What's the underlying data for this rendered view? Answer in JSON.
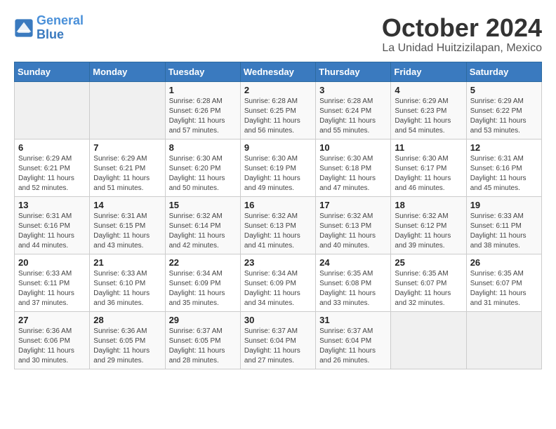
{
  "logo": {
    "line1": "General",
    "line2": "Blue"
  },
  "title": "October 2024",
  "location": "La Unidad Huitzizilapan, Mexico",
  "weekdays": [
    "Sunday",
    "Monday",
    "Tuesday",
    "Wednesday",
    "Thursday",
    "Friday",
    "Saturday"
  ],
  "weeks": [
    [
      {
        "day": "",
        "info": ""
      },
      {
        "day": "",
        "info": ""
      },
      {
        "day": "1",
        "info": "Sunrise: 6:28 AM\nSunset: 6:26 PM\nDaylight: 11 hours and 57 minutes."
      },
      {
        "day": "2",
        "info": "Sunrise: 6:28 AM\nSunset: 6:25 PM\nDaylight: 11 hours and 56 minutes."
      },
      {
        "day": "3",
        "info": "Sunrise: 6:28 AM\nSunset: 6:24 PM\nDaylight: 11 hours and 55 minutes."
      },
      {
        "day": "4",
        "info": "Sunrise: 6:29 AM\nSunset: 6:23 PM\nDaylight: 11 hours and 54 minutes."
      },
      {
        "day": "5",
        "info": "Sunrise: 6:29 AM\nSunset: 6:22 PM\nDaylight: 11 hours and 53 minutes."
      }
    ],
    [
      {
        "day": "6",
        "info": "Sunrise: 6:29 AM\nSunset: 6:21 PM\nDaylight: 11 hours and 52 minutes."
      },
      {
        "day": "7",
        "info": "Sunrise: 6:29 AM\nSunset: 6:21 PM\nDaylight: 11 hours and 51 minutes."
      },
      {
        "day": "8",
        "info": "Sunrise: 6:30 AM\nSunset: 6:20 PM\nDaylight: 11 hours and 50 minutes."
      },
      {
        "day": "9",
        "info": "Sunrise: 6:30 AM\nSunset: 6:19 PM\nDaylight: 11 hours and 49 minutes."
      },
      {
        "day": "10",
        "info": "Sunrise: 6:30 AM\nSunset: 6:18 PM\nDaylight: 11 hours and 47 minutes."
      },
      {
        "day": "11",
        "info": "Sunrise: 6:30 AM\nSunset: 6:17 PM\nDaylight: 11 hours and 46 minutes."
      },
      {
        "day": "12",
        "info": "Sunrise: 6:31 AM\nSunset: 6:16 PM\nDaylight: 11 hours and 45 minutes."
      }
    ],
    [
      {
        "day": "13",
        "info": "Sunrise: 6:31 AM\nSunset: 6:16 PM\nDaylight: 11 hours and 44 minutes."
      },
      {
        "day": "14",
        "info": "Sunrise: 6:31 AM\nSunset: 6:15 PM\nDaylight: 11 hours and 43 minutes."
      },
      {
        "day": "15",
        "info": "Sunrise: 6:32 AM\nSunset: 6:14 PM\nDaylight: 11 hours and 42 minutes."
      },
      {
        "day": "16",
        "info": "Sunrise: 6:32 AM\nSunset: 6:13 PM\nDaylight: 11 hours and 41 minutes."
      },
      {
        "day": "17",
        "info": "Sunrise: 6:32 AM\nSunset: 6:13 PM\nDaylight: 11 hours and 40 minutes."
      },
      {
        "day": "18",
        "info": "Sunrise: 6:32 AM\nSunset: 6:12 PM\nDaylight: 11 hours and 39 minutes."
      },
      {
        "day": "19",
        "info": "Sunrise: 6:33 AM\nSunset: 6:11 PM\nDaylight: 11 hours and 38 minutes."
      }
    ],
    [
      {
        "day": "20",
        "info": "Sunrise: 6:33 AM\nSunset: 6:11 PM\nDaylight: 11 hours and 37 minutes."
      },
      {
        "day": "21",
        "info": "Sunrise: 6:33 AM\nSunset: 6:10 PM\nDaylight: 11 hours and 36 minutes."
      },
      {
        "day": "22",
        "info": "Sunrise: 6:34 AM\nSunset: 6:09 PM\nDaylight: 11 hours and 35 minutes."
      },
      {
        "day": "23",
        "info": "Sunrise: 6:34 AM\nSunset: 6:09 PM\nDaylight: 11 hours and 34 minutes."
      },
      {
        "day": "24",
        "info": "Sunrise: 6:35 AM\nSunset: 6:08 PM\nDaylight: 11 hours and 33 minutes."
      },
      {
        "day": "25",
        "info": "Sunrise: 6:35 AM\nSunset: 6:07 PM\nDaylight: 11 hours and 32 minutes."
      },
      {
        "day": "26",
        "info": "Sunrise: 6:35 AM\nSunset: 6:07 PM\nDaylight: 11 hours and 31 minutes."
      }
    ],
    [
      {
        "day": "27",
        "info": "Sunrise: 6:36 AM\nSunset: 6:06 PM\nDaylight: 11 hours and 30 minutes."
      },
      {
        "day": "28",
        "info": "Sunrise: 6:36 AM\nSunset: 6:05 PM\nDaylight: 11 hours and 29 minutes."
      },
      {
        "day": "29",
        "info": "Sunrise: 6:37 AM\nSunset: 6:05 PM\nDaylight: 11 hours and 28 minutes."
      },
      {
        "day": "30",
        "info": "Sunrise: 6:37 AM\nSunset: 6:04 PM\nDaylight: 11 hours and 27 minutes."
      },
      {
        "day": "31",
        "info": "Sunrise: 6:37 AM\nSunset: 6:04 PM\nDaylight: 11 hours and 26 minutes."
      },
      {
        "day": "",
        "info": ""
      },
      {
        "day": "",
        "info": ""
      }
    ]
  ]
}
